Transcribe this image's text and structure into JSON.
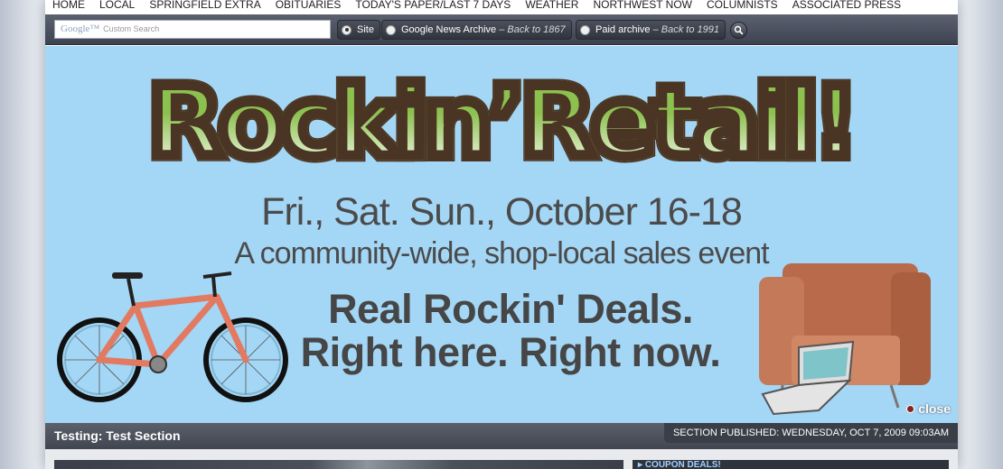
{
  "nav": {
    "items": [
      "HOME",
      "LOCAL",
      "SPRINGFIELD EXTRA",
      "OBITUARIES",
      "TODAY'S PAPER/LAST 7 DAYS",
      "WEATHER",
      "NORTHWEST NOW",
      "COLUMNISTS",
      "ASSOCIATED PRESS"
    ]
  },
  "search": {
    "logo": "Google™",
    "placeholder": "Custom Search",
    "options": [
      {
        "label": "Site",
        "note": "",
        "selected": true
      },
      {
        "label": "Google News Archive",
        "note": "– Back to 1867",
        "selected": false
      },
      {
        "label": "Paid archive",
        "note": "– Back to 1991",
        "selected": false
      }
    ],
    "button_icon": "magnifier-icon"
  },
  "banner": {
    "headline": "Rockin’Retail!",
    "dates": "Fri., Sat. Sun., October 16-18",
    "tagline": "A community-wide, shop-local sales event",
    "deals_line1": "Real Rockin' Deals.",
    "deals_line2": "Right here. Right now.",
    "close_label": "close",
    "background_color": "#a4d6f5",
    "headline_color": "#8cc04f",
    "outline_color": "#4a3423"
  },
  "section": {
    "title": "Testing: Test Section",
    "published": "SECTION PUBLISHED: WEDNESDAY, OCT 7, 2009 09:03AM"
  },
  "sidebar": {
    "coupon_label": "COUPON DEALS!"
  }
}
